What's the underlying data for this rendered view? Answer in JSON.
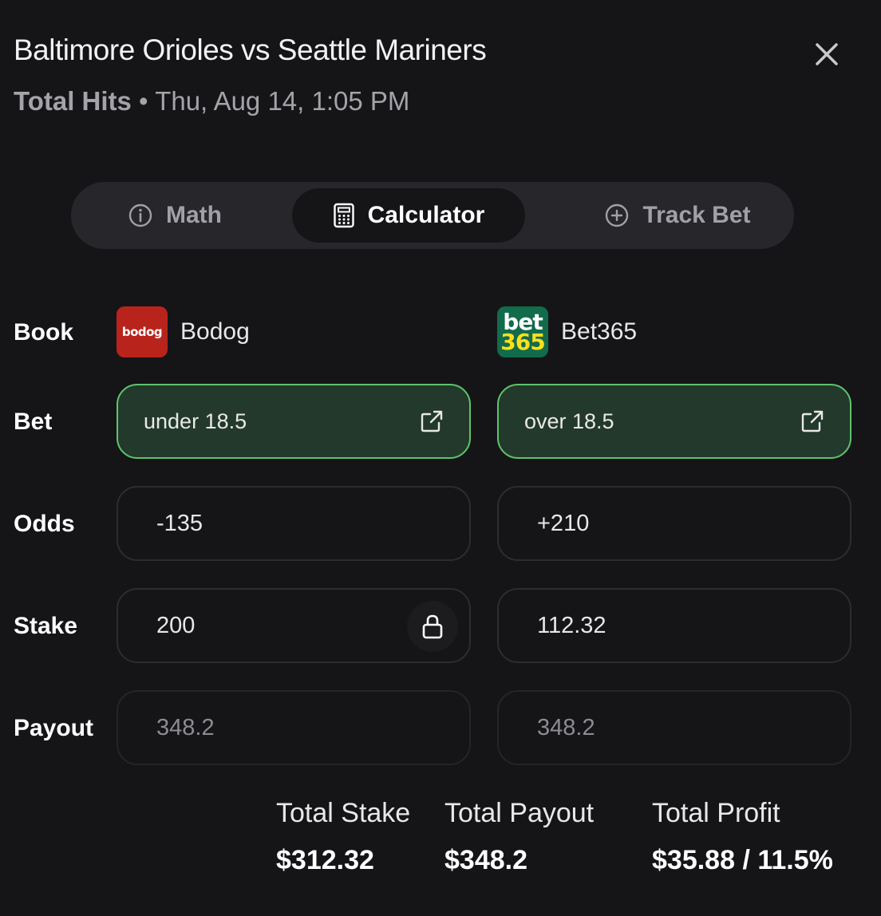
{
  "header": {
    "title": "Baltimore Orioles vs Seattle Mariners",
    "market": "Total Hits",
    "separator": " • ",
    "datetime": "Thu, Aug 14, 1:05 PM"
  },
  "tabs": [
    {
      "label": "Math",
      "icon": "info-icon",
      "active": false
    },
    {
      "label": "Calculator",
      "icon": "calculator-icon",
      "active": true
    },
    {
      "label": "Track Bet",
      "icon": "plus-circle-icon",
      "active": false
    }
  ],
  "labels": {
    "book": "Book",
    "bet": "Bet",
    "odds": "Odds",
    "stake": "Stake",
    "payout": "Payout"
  },
  "books": [
    {
      "name": "Bodog",
      "logo_text": "bodog",
      "logo_color": "#b8241b",
      "bet": "under 18.5",
      "odds": "-135",
      "stake": "200",
      "payout": "348.2"
    },
    {
      "name": "Bet365",
      "logo_text_top": "bet",
      "logo_text_bottom": "365",
      "logo_color": "#126b4b",
      "bet": "over 18.5",
      "odds": "+210",
      "stake": "112.32",
      "payout": "348.2"
    }
  ],
  "totals": {
    "stake_label": "Total Stake",
    "stake_value": "$312.32",
    "payout_label": "Total Payout",
    "payout_value": "$348.2",
    "profit_label": "Total Profit",
    "profit_value": "$35.88 / 11.5%"
  },
  "colors": {
    "background": "#151518",
    "bet_fill": "#23392b",
    "bet_border": "#5ec46d"
  }
}
